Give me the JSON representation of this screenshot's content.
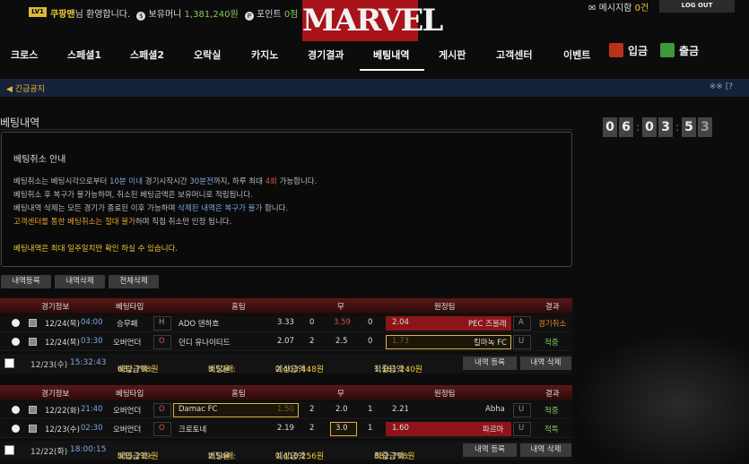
{
  "header": {
    "level_badge": "LV1",
    "username": "쿠팡맨",
    "welcome_suffix": "님 환영합니다.",
    "money_icon": "$",
    "money_label": "보유머니",
    "money_value": "1,381,240원",
    "point_icon": "P",
    "point_label": "포인트",
    "point_value": "0점",
    "logo_text": "MARVEL",
    "message_prefix": "메시지함",
    "message_count": "0건",
    "logout_label": "LOG OUT"
  },
  "nav": {
    "items": [
      "크로스",
      "스페셜1",
      "스페셜2",
      "오락실",
      "카지노",
      "경기결과",
      "베팅내역",
      "게시판",
      "고객센터",
      "이벤트"
    ],
    "deposit_label": "입금",
    "withdraw_label": "출금"
  },
  "notice": {
    "label": "긴급공지",
    "right": "※※ [?"
  },
  "page": {
    "title": "베팅내역"
  },
  "clock": {
    "digits": [
      "0",
      "6",
      "0",
      "3",
      "5",
      "3"
    ]
  },
  "info": {
    "title": "베팅취소 안내",
    "line1": {
      "a": "베팅취소는 베팅시각으로부터 ",
      "b": "10분 이내",
      "c": " 경기시작시간 ",
      "d": "30분전",
      "e": "까지, 하루 최대 ",
      "f": "4회",
      "g": " 가능합니다."
    },
    "line2": "베팅취소 후 복구가 불가능하며, 취소된 베팅금액은 보유머니로 적립됩니다.",
    "line3": {
      "a": "베팅내역 삭제는 모든 경기가 종료된 이후 가능하며 ",
      "b": "삭제된 내역은 복구가 불가",
      "c": " 합니다."
    },
    "line4": {
      "a": "고객센터를 통한 베팅취소는 절대 불가",
      "b": "하며 직접 취소만 인정 됩니다."
    },
    "line5": "베팅내역은 최대 일주일치만 확인 하실 수 있습니다."
  },
  "actions": {
    "register": "내역등록",
    "delete": "내역삭제",
    "delete_all": "전체삭제"
  },
  "columns": {
    "info": "경기정보",
    "type": "베팅타입",
    "home": "홈팀",
    "draw": "무",
    "away": "원정팀",
    "result": "결과"
  },
  "colors": {
    "result_cancel": "#e8872a",
    "result_hit": "#7ecf5a",
    "selected_border": "#d9b24a",
    "red_cell": "#8d1519"
  },
  "bets": [
    {
      "rows": [
        {
          "date": "12/24(목)",
          "time": "04:00",
          "type": "승무패",
          "flag": "H",
          "home": "ADO 덴하흐",
          "home_odds": "3.33",
          "score_h": "0",
          "draw": "3.59",
          "score_a": "0",
          "away_odds": "2.04",
          "away": "PEC 즈볼레",
          "away_flag": "A",
          "result": "경기취소"
        },
        {
          "date": "12/24(목)",
          "time": "03:30",
          "type": "오버언더",
          "flag": "O",
          "home": "던디 유나이티드",
          "home_odds": "2.07",
          "score_h": "2",
          "draw": "2.5",
          "score_a": "0",
          "away_odds": "1.73",
          "away": "킬마녹 FC",
          "away_flag": "U",
          "result": "적중"
        }
      ],
      "summary": {
        "date": "12/23(수)",
        "time": "15:32:43",
        "amount_label": "베팅금액 : ",
        "amount": "682,798원",
        "rate_label": "배당율 : ",
        "rate": "3,52배",
        "expected_label": "예상금액 : ",
        "expected": "2,403,448원",
        "win_label": "적중금액 : ",
        "win": "1,181,240원",
        "reg_btn": "내역 등록",
        "del_btn": "내역 삭제"
      }
    },
    {
      "rows": [
        {
          "date": "12/22(화)",
          "time": "21:40",
          "type": "오버언더",
          "flag": "O",
          "home": "Damac FC",
          "home_odds": "1.50",
          "score_h": "2",
          "draw": "2.0",
          "score_a": "1",
          "away_odds": "2.21",
          "away": "Abha",
          "away_flag": "U",
          "result": "적중"
        },
        {
          "date": "12/23(수)",
          "time": "02:30",
          "type": "오버언더",
          "flag": "O",
          "home": "크로토네",
          "home_odds": "2.19",
          "score_h": "2",
          "draw": "3.0",
          "score_a": "1",
          "away_odds": "1.60",
          "away": "파르마",
          "away_flag": "U",
          "result": "적특"
        }
      ],
      "summary": {
        "date": "12/22(화)",
        "time": "18:00:15",
        "amount_label": "베팅금액 : ",
        "amount": "555,219원",
        "rate_label": "배당율 : ",
        "rate": "2,54배",
        "expected_label": "예상금액 : ",
        "expected": "1,410,256원",
        "win_label": "적중금액 : ",
        "win": "882,798원",
        "reg_btn": "내역 등록",
        "del_btn": "내역 삭제"
      }
    }
  ]
}
